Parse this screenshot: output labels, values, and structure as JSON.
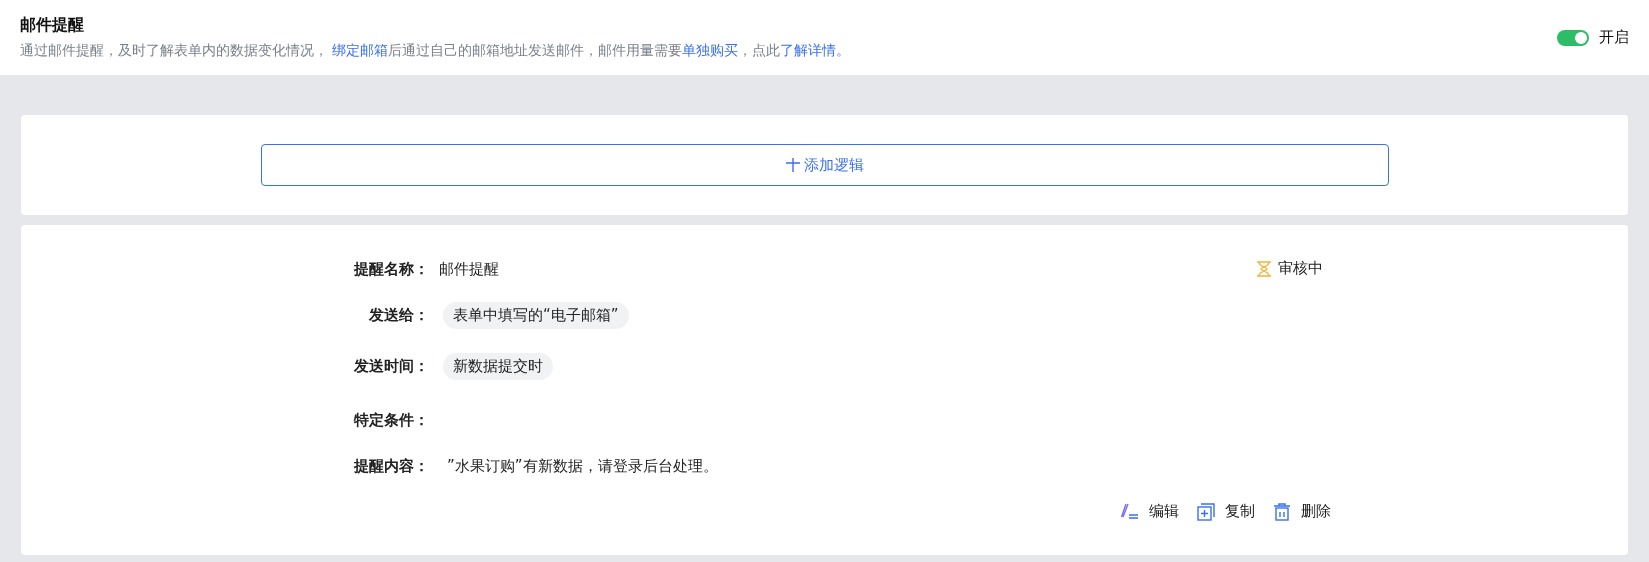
{
  "header": {
    "title": "邮件提醒",
    "description": [
      {
        "kind": "text",
        "text": "通过邮件提醒，及时了解表单内的数据变化情况， "
      },
      {
        "kind": "link",
        "text": "绑定邮箱"
      },
      {
        "kind": "text",
        "text": "后通过自己的邮箱地址发送邮件，邮件用量需要"
      },
      {
        "kind": "link",
        "text": "单独购买"
      },
      {
        "kind": "text",
        "text": "，点此"
      },
      {
        "kind": "link",
        "text": "了解详情。"
      }
    ],
    "toggle": {
      "on": true,
      "label": "开启"
    }
  },
  "add_button": {
    "label": "添加逻辑"
  },
  "rule": {
    "status": "审核中",
    "fields": [
      {
        "label": "提醒名称：",
        "kind": "plain",
        "value": "邮件提醒"
      },
      {
        "label": "发送给：",
        "kind": "tag",
        "value": "表单中填写的“电子邮箱”"
      },
      {
        "label": "发送时间：",
        "kind": "tag",
        "value": "新数据提交时"
      },
      {
        "label": "特定条件：",
        "kind": "empty"
      },
      {
        "label": "提醒内容：",
        "kind": "plain",
        "value": "”水果订购”有新数据，请登录后台处理。"
      }
    ],
    "actions": [
      {
        "kind": "edit",
        "label": "编辑"
      },
      {
        "kind": "copy",
        "label": "复制"
      },
      {
        "kind": "delete",
        "label": "删除"
      }
    ]
  }
}
